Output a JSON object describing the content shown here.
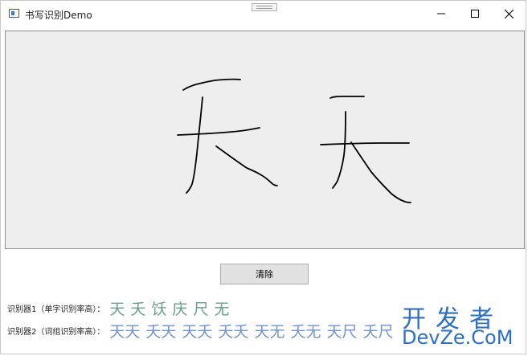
{
  "window": {
    "title": "书写识别Demo",
    "controls": {
      "minimize": "minimize-icon",
      "maximize": "maximize-icon",
      "close": "close-icon"
    }
  },
  "canvas": {
    "ink_color": "#000000",
    "background": "#eeeeee"
  },
  "clear_button": {
    "label": "清除"
  },
  "recognizer1": {
    "label": "识别器1（单字识别率高）：",
    "candidates": [
      "天",
      "夭",
      "饫",
      "庆",
      "尺",
      "无"
    ]
  },
  "recognizer2": {
    "label": "识别器2（词组识别率高）：",
    "candidates": [
      "天天",
      "夭天",
      "天夭",
      "夭夭",
      "天无",
      "夭无",
      "天尺",
      "夭尺"
    ]
  },
  "watermark": {
    "top": "开发者",
    "bottom": "DevZe.CoM",
    "color": "#2b6fc9"
  }
}
